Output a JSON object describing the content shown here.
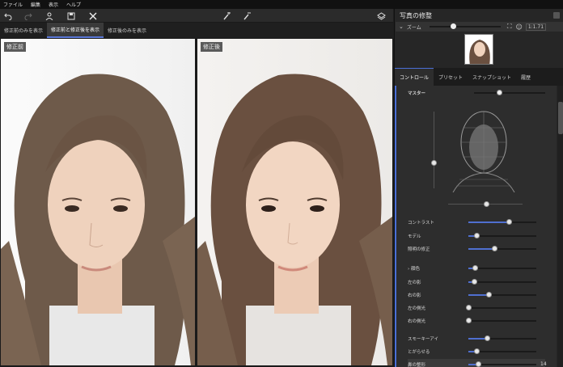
{
  "menu": [
    "ファイル",
    "編集",
    "表示",
    "ヘルプ"
  ],
  "view_tabs": [
    "修正前のみを表示",
    "修正前と修正後を表示",
    "修正後のみを表示"
  ],
  "photo_labels": {
    "before": "修正前",
    "after": "修正後"
  },
  "sidebar": {
    "title": "写真の修整",
    "zoom_label": "ズーム",
    "zoom_ratio": "1:1.71",
    "zoom_level": 0.3
  },
  "panel_tabs": [
    "コントロール",
    "プリセット",
    "スナップショット",
    "履歴"
  ],
  "master_label": "マスター",
  "sliders": [
    {
      "label": "コントラスト",
      "level": 0.6
    },
    {
      "label": "モデル",
      "level": 0.12
    },
    {
      "label": "照明の修正",
      "level": 0.38
    },
    {
      "label": "顔色",
      "level": 0.1,
      "expandable": true
    },
    {
      "label": "左の影",
      "level": 0.08
    },
    {
      "label": "右の影",
      "level": 0.3
    },
    {
      "label": "左の側光",
      "level": 0.0
    },
    {
      "label": "右の側光",
      "level": 0.0
    },
    {
      "label": "スモーキーアイ",
      "level": 0.27
    },
    {
      "label": "とがらせる",
      "level": 0.12
    },
    {
      "label": "鼻の整形",
      "level": 0.14,
      "value": "14"
    }
  ],
  "master_level": 0.35,
  "colors": {
    "accent": "#4f6fd0",
    "panel": "#2d2d2d"
  }
}
